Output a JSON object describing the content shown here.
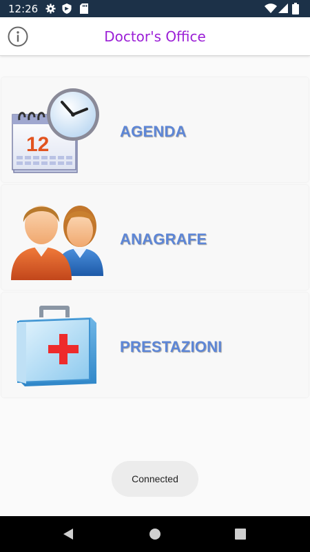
{
  "status_bar": {
    "time": "12:26",
    "left_icons": [
      "gear-icon",
      "shield-icon",
      "sd-card-icon"
    ],
    "right_icons": [
      "wifi-icon",
      "signal-icon",
      "battery-icon"
    ],
    "background": "#1c3148"
  },
  "app_bar": {
    "title": "Doctor's Office",
    "title_color": "#9b1fd6",
    "info_icon": "info-icon"
  },
  "menu": {
    "items": [
      {
        "label": "AGENDA",
        "icon": "calendar-clock-icon"
      },
      {
        "label": "ANAGRAFE",
        "icon": "people-icon"
      },
      {
        "label": "PRESTAZIONI",
        "icon": "medical-kit-icon"
      }
    ],
    "label_color": "#5d86d6"
  },
  "toast": {
    "text": "Connected"
  },
  "nav_bar": {
    "icons": [
      "back-icon",
      "home-icon",
      "recents-icon"
    ]
  }
}
